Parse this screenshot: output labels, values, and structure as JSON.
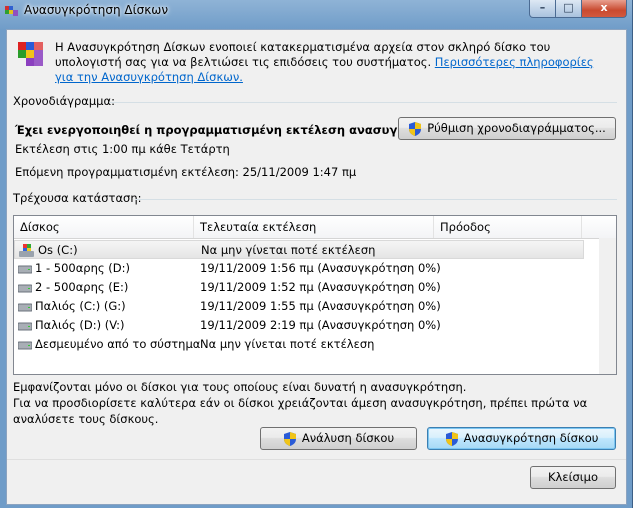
{
  "window": {
    "title": "Ανασυγκρότηση Δίσκων",
    "min_label": "–",
    "max_label": "□",
    "close_label": "x"
  },
  "intro": {
    "text": "Η Ανασυγκρότηση Δίσκων ενοποιεί κατακερματισμένα αρχεία στον σκληρό δίσκο του υπολογιστή σας για να βελτιώσει τις επιδόσεις του συστήματος.",
    "link": "Περισσότερες πληροφορίες για την Ανασυγκρότηση Δίσκων."
  },
  "schedule": {
    "label": "Χρονοδιάγραμμα:",
    "status": "Έχει ενεργοποιηθεί η προγραμματισμένη εκτέλεση ανασυγκρό...",
    "run_at": "Εκτέλεση στις 1:00 πμ κάθε Τετάρτη",
    "next_run": "Επόμενη προγραμματισμένη εκτέλεση: 25/11/2009 1:47 πμ",
    "configure_button": "Ρύθμιση χρονοδιαγράμματος..."
  },
  "current_status": {
    "label": "Τρέχουσα κατάσταση:",
    "columns": [
      "Δίσκος",
      "Τελευταία εκτέλεση",
      "Πρόοδος"
    ],
    "rows": [
      {
        "disk": "Os (C:)",
        "last_run": "Να μην γίνεται ποτέ εκτέλεση",
        "progress": "",
        "icon": "windows-drive-icon"
      },
      {
        "disk": "1 - 500αρης  (D:)",
        "last_run": "19/11/2009 1:56 πμ (Ανασυγκρότηση 0%)",
        "progress": "",
        "icon": "drive-icon"
      },
      {
        "disk": "2 - 500αρης  (E:)",
        "last_run": "19/11/2009 1:52 πμ (Ανασυγκρότηση 0%)",
        "progress": "",
        "icon": "drive-icon"
      },
      {
        "disk": "Παλιός (C:) (G:)",
        "last_run": "19/11/2009 1:55 πμ (Ανασυγκρότηση 0%)",
        "progress": "",
        "icon": "drive-icon"
      },
      {
        "disk": "Παλιός (D:) (V:)",
        "last_run": "19/11/2009 2:19 πμ (Ανασυγκρότηση 0%)",
        "progress": "",
        "icon": "drive-icon"
      },
      {
        "disk": "Δεσμευμένο από το σύστημα",
        "last_run": "Να μην γίνεται ποτέ εκτέλεση",
        "progress": "",
        "icon": "drive-icon"
      }
    ]
  },
  "notes": {
    "line1": "Εμφανίζονται μόνο οι δίσκοι για τους οποίους είναι δυνατή η ανασυγκρότηση.",
    "line2": "Για να προσδιορίσετε καλύτερα εάν οι δίσκοι χρειάζονται άμεση ανασυγκρότηση, πρέπει πρώτα να αναλύσετε τους δίσκους."
  },
  "actions": {
    "analyze_button": "Ανάλυση δίσκου",
    "defrag_button": "Ανασυγκρότηση δίσκου",
    "close_button": "Κλείσιμο"
  }
}
